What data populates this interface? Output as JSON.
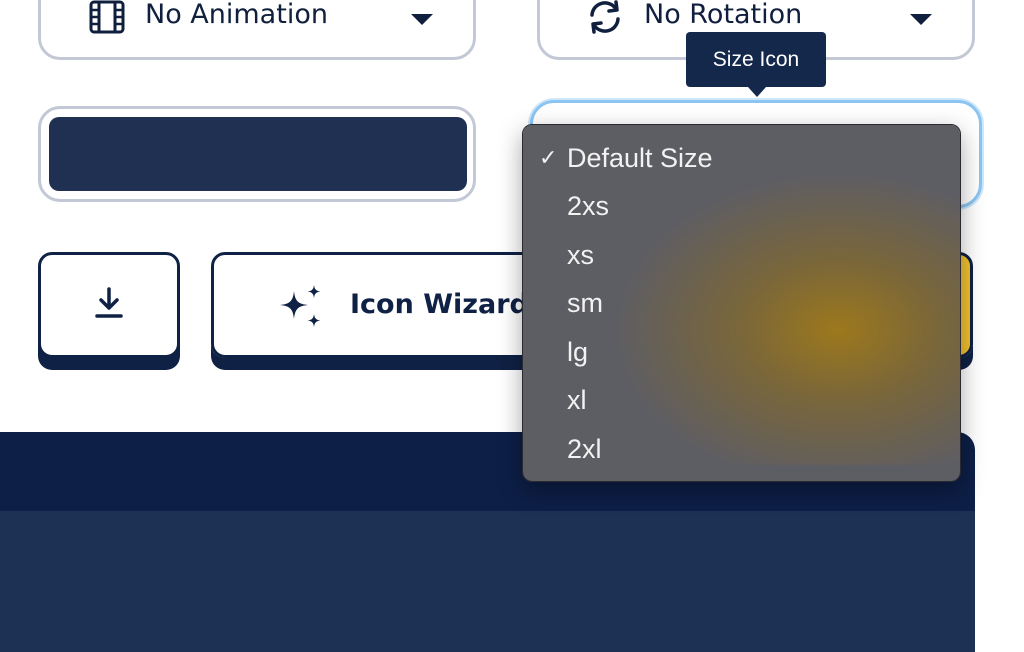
{
  "animation_select": {
    "label": "No Animation",
    "icon": "film-icon"
  },
  "rotation_select": {
    "label": "No Rotation",
    "icon": "rotate-icon"
  },
  "color_field": {
    "color": "#1f3052"
  },
  "tooltip": {
    "text": "Size Icon"
  },
  "size_dropdown": {
    "selected": "Default Size",
    "check_mark": "✓",
    "options": [
      "Default Size",
      "2xs",
      "xs",
      "sm",
      "lg",
      "xl",
      "2xl"
    ]
  },
  "download_button": {
    "icon": "download-icon"
  },
  "wizard_button": {
    "label": "Icon Wizard",
    "icon": "sparkles-icon"
  },
  "colors": {
    "navy": "#0f2144",
    "accent_yellow": "#f2c230",
    "focus_blue": "#8cc5f2"
  }
}
